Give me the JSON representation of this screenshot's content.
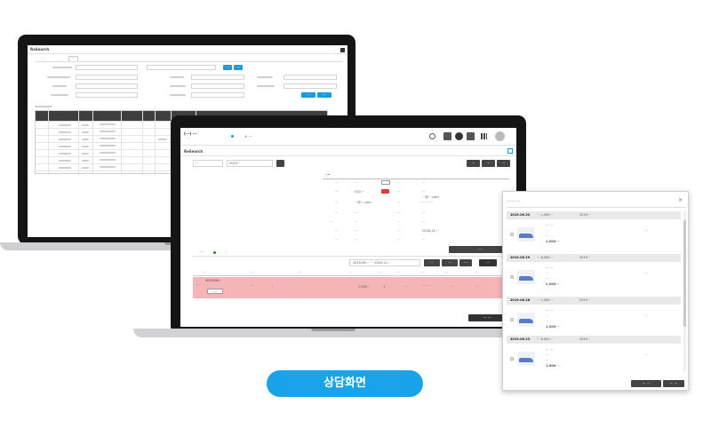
{
  "caption": "상담화면",
  "back_window": {
    "title": "ReSearch",
    "tabs": [
      "···",
      "···"
    ],
    "buttons": [
      "···",
      "···",
      "···",
      "···"
    ]
  },
  "front_window": {
    "header_title": "(···) ···",
    "header_sub": "···",
    "header_tab": "+ ···",
    "toolbar_label": "ReSearch",
    "search_select": "···",
    "search_value": "2019···",
    "top_buttons": [
      "···",
      "···",
      "···"
    ],
    "customer_panel_title": "···",
    "customer_email": "···@···.com",
    "customer_rows": [
      {
        "label": "···",
        "value": "···"
      },
      {
        "label": "···",
        "value": "010-···"
      },
      {
        "label": "···",
        "value": "···@···.com"
      },
      {
        "label": "···",
        "value": "···"
      },
      {
        "label": "···",
        "value": "···"
      },
      {
        "label": "···",
        "value": "···"
      },
      {
        "label": "···",
        "value": "···"
      }
    ],
    "customer_rows_right": [
      {
        "label": "···",
        "value": "···"
      },
      {
        "label": "···",
        "value": "···"
      },
      {
        "label": "···",
        "value": "··· ··· ···"
      },
      {
        "label": "···",
        "value": "···"
      },
      {
        "label": "···",
        "value": "···"
      },
      {
        "label": "···",
        "value": "2018-11-···"
      },
      {
        "label": "···",
        "value": "···"
      }
    ],
    "order_tabs": [
      "···",
      "···"
    ],
    "date_range": "2019-06-··· ~ 2019-11-···",
    "period_buttons": [
      "···",
      "···",
      "···",
      "···"
    ],
    "right_tag_button": "···",
    "table_headers": [
      "···",
      "···",
      "···",
      "···",
      "···",
      "···",
      "···",
      "···",
      "···"
    ],
    "row_order_no": "2019-06-···",
    "row_link": "···",
    "row_cells": [
      "···",
      "···",
      "1,000 ···",
      "1",
      "···",
      "··· ···",
      "···",
      "···"
    ],
    "row_button": "···",
    "bottom_button": "··· ···"
  },
  "popup": {
    "title": "··· ··· ···",
    "orders": [
      {
        "date": "2019.06.30",
        "meta": "··· 1,000···",
        "order_no": "2019···"
      },
      {
        "date": "2019.06.29",
        "meta": "··· 6,000···",
        "order_no": "2019···"
      },
      {
        "date": "2019.06.28",
        "meta": "··· 1,000···",
        "order_no": "2019···"
      },
      {
        "date": "2019.06.23",
        "meta": "··· 6,000···",
        "order_no": "2019···"
      }
    ],
    "item_name": "··· ···",
    "item_option": "···",
    "item_qty": "···",
    "item_price": "1,000···",
    "item_status": "···",
    "buttons": [
      "··· ···",
      "··· ···"
    ]
  },
  "colors": {
    "accent": "#1a9be0",
    "caption_bg": "#1aa3e8",
    "highlight_row": "#f5b5b8",
    "dark_button": "#3a3a3a"
  }
}
